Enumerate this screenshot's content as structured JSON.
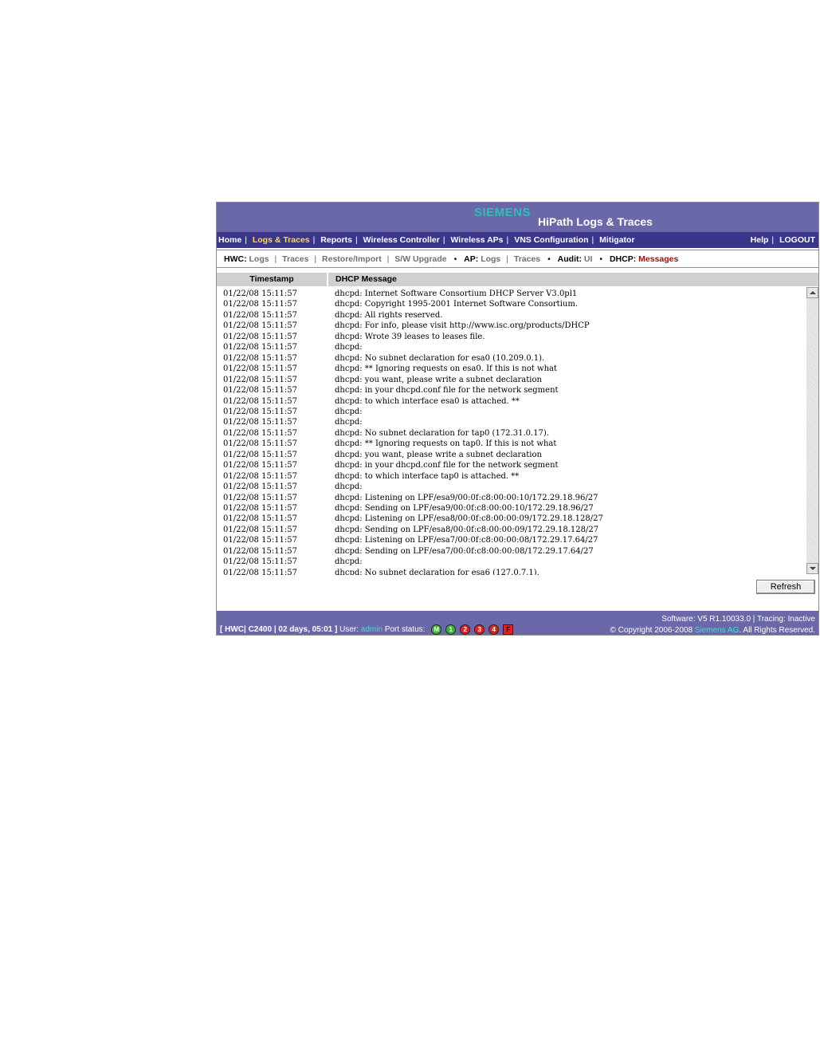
{
  "brand": "SIEMENS",
  "app_title": "HiPath Logs & Traces",
  "nav": {
    "left": [
      "Home",
      "Logs & Traces",
      "Reports",
      "Wireless Controller",
      "Wireless APs",
      "VNS Configuration",
      "Mitigator"
    ],
    "active": "Logs & Traces",
    "right": [
      "Help",
      "LOGOUT"
    ]
  },
  "subnav": {
    "hwc_label": "HWC:",
    "hwc_links": [
      "Logs",
      "Traces",
      "Restore/Import",
      "S/W Upgrade"
    ],
    "ap_label": "AP:",
    "ap_links": [
      "Logs",
      "Traces"
    ],
    "audit_label": "Audit:",
    "audit_links": [
      "UI"
    ],
    "dhcp_label": "DHCP:",
    "dhcp_links": [
      "Messages"
    ]
  },
  "table": {
    "col_timestamp": "Timestamp",
    "col_message": "DHCP Message",
    "rows": [
      {
        "ts": "01/22/08 15:11:57",
        "msg": "dhcpd: Internet Software Consortium DHCP Server V3.0pl1"
      },
      {
        "ts": "01/22/08 15:11:57",
        "msg": "dhcpd: Copyright 1995-2001 Internet Software Consortium."
      },
      {
        "ts": "01/22/08 15:11:57",
        "msg": "dhcpd: All rights reserved."
      },
      {
        "ts": "01/22/08 15:11:57",
        "msg": "dhcpd: For info, please visit http://www.isc.org/products/DHCP"
      },
      {
        "ts": "01/22/08 15:11:57",
        "msg": "dhcpd: Wrote 39 leases to leases file."
      },
      {
        "ts": "01/22/08 15:11:57",
        "msg": "dhcpd:"
      },
      {
        "ts": "01/22/08 15:11:57",
        "msg": "dhcpd: No subnet declaration for esa0 (10.209.0.1)."
      },
      {
        "ts": "01/22/08 15:11:57",
        "msg": "dhcpd: ** Ignoring requests on esa0. If this is not what"
      },
      {
        "ts": "01/22/08 15:11:57",
        "msg": "dhcpd: you want, please write a subnet declaration"
      },
      {
        "ts": "01/22/08 15:11:57",
        "msg": "dhcpd: in your dhcpd.conf file for the network segment"
      },
      {
        "ts": "01/22/08 15:11:57",
        "msg": "dhcpd: to which interface esa0 is attached. **"
      },
      {
        "ts": "01/22/08 15:11:57",
        "msg": "dhcpd:"
      },
      {
        "ts": "01/22/08 15:11:57",
        "msg": "dhcpd:"
      },
      {
        "ts": "01/22/08 15:11:57",
        "msg": "dhcpd: No subnet declaration for tap0 (172.31.0.17)."
      },
      {
        "ts": "01/22/08 15:11:57",
        "msg": "dhcpd: ** Ignoring requests on tap0. If this is not what"
      },
      {
        "ts": "01/22/08 15:11:57",
        "msg": "dhcpd: you want, please write a subnet declaration"
      },
      {
        "ts": "01/22/08 15:11:57",
        "msg": "dhcpd: in your dhcpd.conf file for the network segment"
      },
      {
        "ts": "01/22/08 15:11:57",
        "msg": "dhcpd: to which interface tap0 is attached. **"
      },
      {
        "ts": "01/22/08 15:11:57",
        "msg": "dhcpd:"
      },
      {
        "ts": "01/22/08 15:11:57",
        "msg": "dhcpd: Listening on LPF/esa9/00:0f:c8:00:00:10/172.29.18.96/27"
      },
      {
        "ts": "01/22/08 15:11:57",
        "msg": "dhcpd: Sending on LPF/esa9/00:0f:c8:00:00:10/172.29.18.96/27"
      },
      {
        "ts": "01/22/08 15:11:57",
        "msg": "dhcpd: Listening on LPF/esa8/00:0f:c8:00:00:09/172.29.18.128/27"
      },
      {
        "ts": "01/22/08 15:11:57",
        "msg": "dhcpd: Sending on LPF/esa8/00:0f:c8:00:00:09/172.29.18.128/27"
      },
      {
        "ts": "01/22/08 15:11:57",
        "msg": "dhcpd: Listening on LPF/esa7/00:0f:c8:00:00:08/172.29.17.64/27"
      },
      {
        "ts": "01/22/08 15:11:57",
        "msg": "dhcpd: Sending on LPF/esa7/00:0f:c8:00:00:08/172.29.17.64/27"
      },
      {
        "ts": "01/22/08 15:11:57",
        "msg": "dhcpd:"
      },
      {
        "ts": "01/22/08 15:11:57",
        "msg": "dhcpd: No subnet declaration for esa6 (127.0.7.1)."
      }
    ]
  },
  "refresh_label": "Refresh",
  "footer": {
    "hwc": "[ HWC| C2400 | 02 days, 05:01 ]",
    "user_label": "User:",
    "user_name": "admin",
    "port_label": "Port status:",
    "ports": [
      {
        "label": "M",
        "color": "#3fb03f"
      },
      {
        "label": "1",
        "color": "#3fb03f"
      },
      {
        "label": "2",
        "color": "#e22020"
      },
      {
        "label": "3",
        "color": "#e22020"
      },
      {
        "label": "4",
        "color": "#e22020"
      },
      {
        "label": "F",
        "color": "#e22020"
      }
    ],
    "software_line": "Software: V5 R1.10033.0 | Tracing: Inactive",
    "copyright_prefix": "© Copyright  2006-2008",
    "company": "Siemens AG",
    "copyright_suffix": ". All Rights Reserved."
  }
}
